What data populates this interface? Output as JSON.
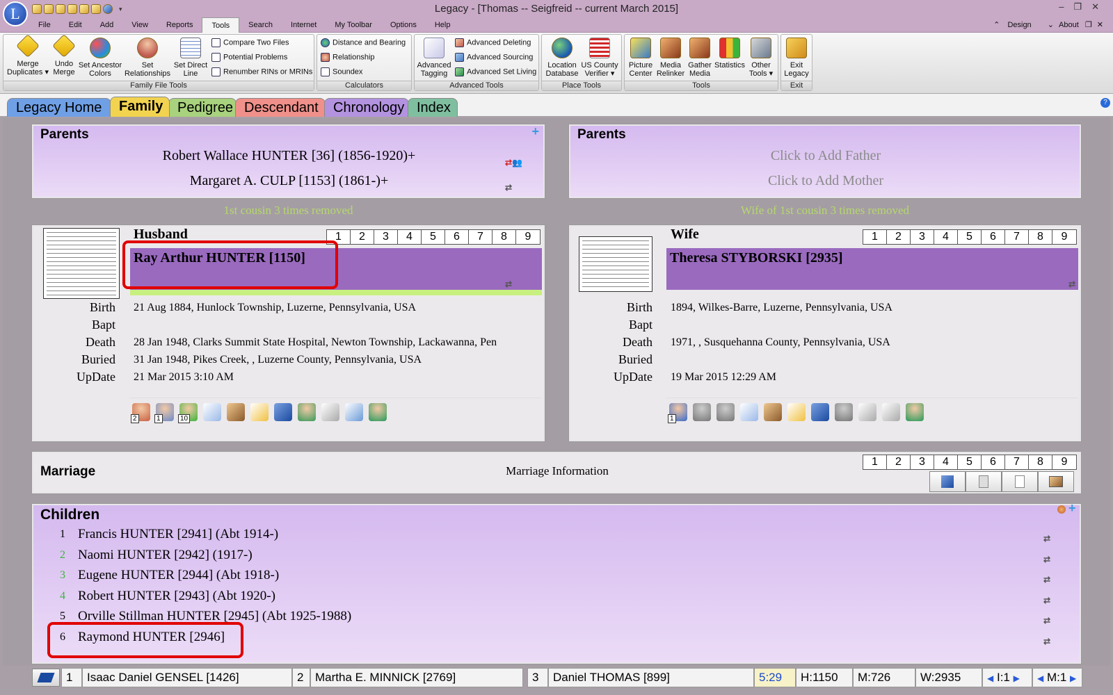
{
  "window": {
    "title": "Legacy - [Thomas -- Seigfreid -- current March 2015]",
    "app_letter": "L"
  },
  "menu": [
    "File",
    "Edit",
    "Add",
    "View",
    "Reports",
    "Tools",
    "Search",
    "Internet",
    "My Toolbar",
    "Options",
    "Help"
  ],
  "menu_active": "Tools",
  "menu_right": {
    "design": "Design",
    "about": "About"
  },
  "ribbon": {
    "groups": [
      {
        "label": "Family File Tools"
      },
      {
        "label": "Calculators"
      },
      {
        "label": "Advanced Tools"
      },
      {
        "label": "Place Tools"
      },
      {
        "label": "Tools"
      },
      {
        "label": "Exit"
      }
    ],
    "buttons": {
      "merge_duplicates": [
        "Merge",
        "Duplicates"
      ],
      "undo_merge": [
        "Undo",
        "Merge"
      ],
      "set_ancestor_colors": [
        "Set Ancestor",
        "Colors"
      ],
      "set_relationships": [
        "Set",
        "Relationships"
      ],
      "set_direct_line": [
        "Set Direct",
        "Line"
      ],
      "compare_two_files": "Compare Two Files",
      "potential_problems": "Potential Problems",
      "renumber_rins": "Renumber RINs or MRINs",
      "distance_bearing": "Distance and Bearing",
      "relationship": "Relationship",
      "soundex": "Soundex",
      "advanced_tagging": [
        "Advanced",
        "Tagging"
      ],
      "advanced_deleting": "Advanced Deleting",
      "advanced_sourcing": "Advanced Sourcing",
      "advanced_set_living": "Advanced Set Living",
      "location_database": [
        "Location",
        "Database"
      ],
      "us_county_verifier": [
        "US County",
        "Verifier"
      ],
      "picture_center": [
        "Picture",
        "Center"
      ],
      "media_relinker": [
        "Media",
        "Relinker"
      ],
      "gather_media": [
        "Gather",
        "Media"
      ],
      "statistics": "Statistics",
      "other_tools": [
        "Other",
        "Tools"
      ],
      "exit_legacy": [
        "Exit",
        "Legacy"
      ]
    }
  },
  "view_tabs": [
    {
      "label": "Legacy Home",
      "color": "#6fa0e6"
    },
    {
      "label": "Family",
      "color": "#f2d350"
    },
    {
      "label": "Pedigree",
      "color": "#a8d27d"
    },
    {
      "label": "Descendant",
      "color": "#f0908a"
    },
    {
      "label": "Chronology",
      "color": "#b392e0"
    },
    {
      "label": "Index",
      "color": "#7fbfa0"
    }
  ],
  "husband_parents": {
    "heading": "Parents",
    "father": "Robert Wallace HUNTER [36] (1856-1920)+",
    "mother": "Margaret A. CULP [1153] (1861-)+",
    "relation": "1st cousin 3 times removed"
  },
  "wife_parents": {
    "heading": "Parents",
    "father": "Click to Add Father",
    "mother": "Click to Add Mother",
    "relation": "Wife of 1st cousin 3 times removed"
  },
  "numbers": [
    "1",
    "2",
    "3",
    "4",
    "5",
    "6",
    "7",
    "8",
    "9"
  ],
  "husband": {
    "heading": "Husband",
    "name": "Ray Arthur HUNTER [1150]",
    "events": [
      {
        "label": "Birth",
        "value": "21 Aug 1884, Hunlock Township, Luzerne, Pennsylvania, USA"
      },
      {
        "label": "Bapt",
        "value": ""
      },
      {
        "label": "Death",
        "value": "28 Jan 1948, Clarks Summit State Hospital, Newton Township, Lackawanna, Pen"
      },
      {
        "label": "Buried",
        "value": "31 Jan 1948, Pikes Creek, , Luzerne County, Pennsylvania, USA"
      },
      {
        "label": "UpDate",
        "value": "21 Mar 2015 3:10 AM"
      }
    ],
    "icon_counts": [
      "2",
      "1",
      "10"
    ]
  },
  "wife": {
    "heading": "Wife",
    "name": "Theresa STYBORSKI [2935]",
    "events": [
      {
        "label": "Birth",
        "value": "1894, Wilkes-Barre, Luzerne, Pennsylvania, USA"
      },
      {
        "label": "Bapt",
        "value": ""
      },
      {
        "label": "Death",
        "value": "1971, , Susquehanna County, Pennsylvania, USA"
      },
      {
        "label": "Buried",
        "value": ""
      },
      {
        "label": "UpDate",
        "value": "19 Mar 2015 12:29 AM"
      }
    ],
    "icon_counts": [
      "1"
    ]
  },
  "marriage": {
    "heading": "Marriage",
    "info": "Marriage Information"
  },
  "children": {
    "heading": "Children",
    "items": [
      {
        "num": "1",
        "text": "Francis HUNTER [2941] (Abt 1914-)",
        "num_color": "#000000"
      },
      {
        "num": "2",
        "text": "Naomi HUNTER [2942] (1917-)",
        "num_color": "#3cb43c"
      },
      {
        "num": "3",
        "text": "Eugene HUNTER [2944] (Abt 1918-)",
        "num_color": "#3cb43c"
      },
      {
        "num": "4",
        "text": "Robert HUNTER [2943] (Abt 1920-)",
        "num_color": "#3cb43c"
      },
      {
        "num": "5",
        "text": "Orville Stillman HUNTER [2945] (Abt 1925-1988)",
        "num_color": "#000000"
      },
      {
        "num": "6",
        "text": "Raymond HUNTER [2946]",
        "num_color": "#000000"
      }
    ]
  },
  "status": {
    "slot1_num": "1",
    "slot1_name": "Isaac Daniel GENSEL [1426]",
    "slot2_num": "2",
    "slot2_name": "Martha E. MINNICK [2769]",
    "slot3_num": "3",
    "slot3_name": "Daniel THOMAS [899]",
    "time": "5:29",
    "h": "H:1150",
    "m": "M:726",
    "w": "W:2935",
    "i": "I:1",
    "m2": "M:1"
  },
  "colors": {
    "title_bar": "#c8a9c6",
    "name_bar": "#9a6abf",
    "purple_panel": "#e2cdf5",
    "highlight": "#e10000",
    "relation_text": "#b4d96b"
  }
}
